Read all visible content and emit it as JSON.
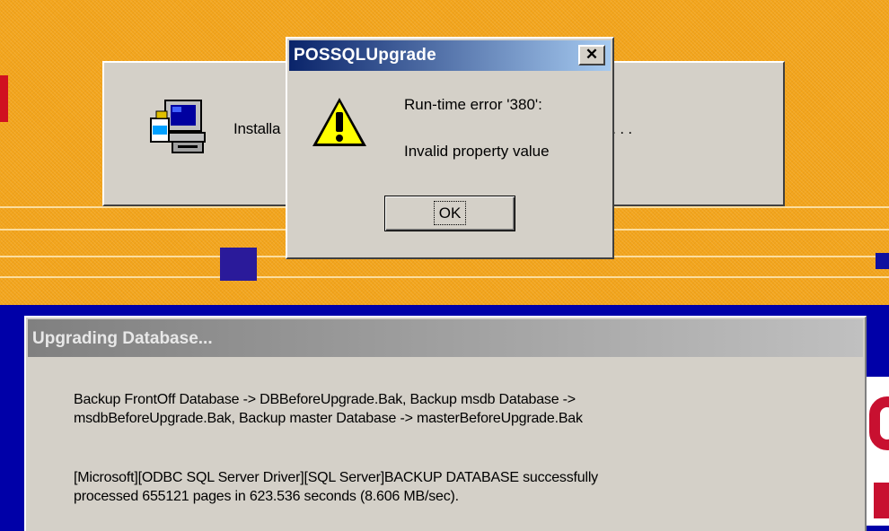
{
  "install_dialog": {
    "text_left": "Installa",
    "text_right": "se wait . . ."
  },
  "message_box": {
    "title": "POSSQLUpgrade",
    "close_glyph": "✕",
    "icon": "warning-icon",
    "line1": "Run-time error '380':",
    "line2": "Invalid property value",
    "ok_label": "OK"
  },
  "upgrade_window": {
    "title": "Upgrading Database...",
    "log_line1": "Backup FrontOff Database -> DBBeforeUpgrade.Bak,  Backup msdb Database ->",
    "log_line2": "msdbBeforeUpgrade.Bak,  Backup master Database -> masterBeforeUpgrade.Bak",
    "log_line3": "[Microsoft][ODBC SQL Server Driver][SQL Server]BACKUP DATABASE successfully",
    "log_line4": "processed 655121 pages in 623.536 seconds (8.606 MB/sec)."
  },
  "colors": {
    "desktop_orange": "#f3a51c",
    "desktop_blue": "#0000a8",
    "active_title": "#0a246a",
    "inactive_title": "#808080",
    "dialog_face": "#d4d0c8"
  }
}
